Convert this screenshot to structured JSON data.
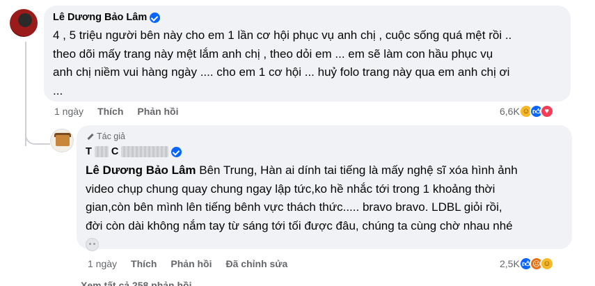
{
  "main_comment": {
    "author": "Lê Dương Bảo Lâm",
    "lines": [
      "4 , 5 triệu người bên này cho em 1 lần cơ hội phục vụ anh chị , cuộc sống quá mệt rồi ..",
      "theo dõi mấy trang này mệt lắm anh chị , theo dỏi em ... em sẽ làm con hầu phục vụ",
      "anh chị niềm vui hàng ngày .... cho em 1 cơ hội ... huỷ folo trang này qua em anh chị ơi",
      "..."
    ],
    "time": "1 ngày",
    "like_label": "Thích",
    "reply_label": "Phản hồi",
    "reaction_count": "6,6K",
    "reactions": [
      "haha",
      "like",
      "love"
    ]
  },
  "reply_comment": {
    "badge": "Tác giả",
    "author_initial_1": "T",
    "author_initial_2": "C",
    "mention": "Lê Dương Bảo Lâm",
    "lines": [
      " Bên Trung, Hàn ai dính tai tiếng là mấy nghệ sĩ xóa hình ảnh",
      "video chụp chung quay chung ngay lập tức,ko hề nhắc tới trong 1 khoảng thời",
      "gian,còn bên mình lên tiếng bênh vực thách thức..... bravo bravo. LDBL giỏi rồi,",
      "đời còn dài không nắm tay từ sáng tới tối được đâu, chúng ta cùng chờ nhau nhé"
    ],
    "time": "1 ngày",
    "like_label": "Thích",
    "reply_label": "Phản hồi",
    "edited_label": "Đã chỉnh sửa",
    "reaction_count": "2,5K",
    "reactions": [
      "like",
      "angry",
      "haha"
    ]
  },
  "more_replies": "Xem tất cả 258 phản hồi"
}
